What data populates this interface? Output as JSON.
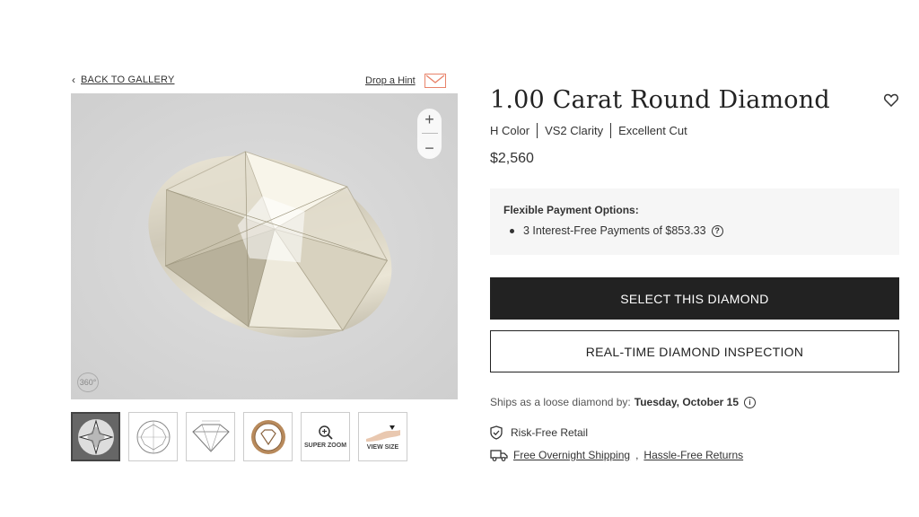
{
  "nav": {
    "back_label": "BACK TO GALLERY",
    "hint_label": "Drop a Hint"
  },
  "viewer": {
    "zoom_in": "+",
    "zoom_out": "−",
    "spin_label": "360°"
  },
  "thumbnails": [
    {
      "icon": "diamond-top-image",
      "label": ""
    },
    {
      "icon": "diamond-outline-top",
      "label": ""
    },
    {
      "icon": "diamond-profile-diagram",
      "label": ""
    },
    {
      "icon": "certificate-seal",
      "label": ""
    },
    {
      "icon": "super-zoom-icon",
      "label": "SUPER ZOOM"
    },
    {
      "icon": "hand-ring-icon",
      "label": "VIEW SIZE"
    }
  ],
  "product": {
    "title": "1.00 Carat Round Diamond",
    "color": "H Color",
    "clarity": "VS2 Clarity",
    "cut": "Excellent Cut",
    "price": "$2,560"
  },
  "payment": {
    "heading": "Flexible Payment Options:",
    "item": "3 Interest-Free Payments of $853.33",
    "help": "?"
  },
  "buttons": {
    "select": "SELECT THIS DIAMOND",
    "inspect": "REAL-TIME DIAMOND INSPECTION"
  },
  "shipping": {
    "prefix": "Ships as a loose diamond by:",
    "date": "Tuesday, October 15",
    "info": "i",
    "risk_free": "Risk-Free Retail",
    "overnight": "Free Overnight Shipping",
    "sep": ",",
    "returns": "Hassle-Free Returns"
  },
  "colors": {
    "primary_button": "#222222",
    "hint_accent": "#e8836a",
    "panel_bg": "#f6f6f6"
  }
}
